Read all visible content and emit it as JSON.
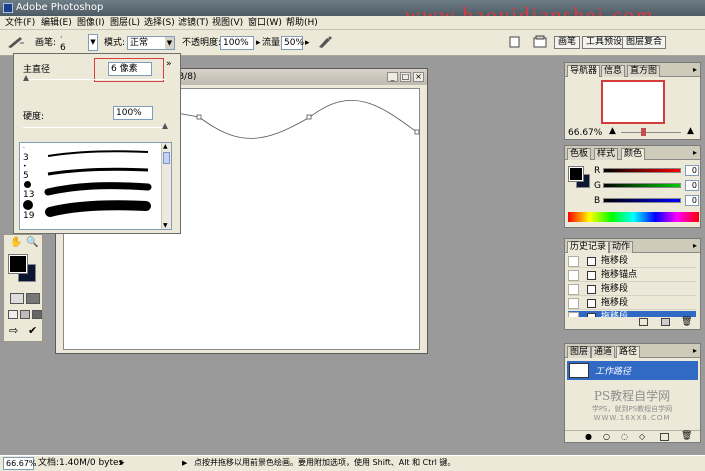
{
  "app": {
    "title": "Adobe Photoshop"
  },
  "watermark_top": "www.haoyidianshej.com",
  "menu": [
    {
      "label": "文件(F)"
    },
    {
      "label": "编辑(E)"
    },
    {
      "label": "图像(I)"
    },
    {
      "label": "图层(L)"
    },
    {
      "label": "选择(S)"
    },
    {
      "label": "滤镜(T)"
    },
    {
      "label": "视图(V)"
    },
    {
      "label": "窗口(W)"
    },
    {
      "label": "帮助(H)"
    }
  ],
  "options": {
    "brush_label": "画笔:",
    "brush_size": "6",
    "mode_label": "模式:",
    "mode_value": "正常",
    "opacity_label": "不透明度:",
    "opacity_value": "100%",
    "flow_label": "流量:",
    "flow_value": "50%"
  },
  "palette_well_tabs": [
    {
      "label": "画笔"
    },
    {
      "label": "工具预设"
    },
    {
      "label": "图层复合"
    }
  ],
  "brush_popup": {
    "master_diameter_label": "主直径",
    "master_diameter_value": "6 像素",
    "master_diameter_fraction": 0.02,
    "hardness_label": "硬度:",
    "hardness_value": "100%",
    "hardness_fraction": 1.0,
    "brushes": [
      {
        "size": "3",
        "stroke": 2
      },
      {
        "size": "5",
        "stroke": 3
      },
      {
        "size": "13",
        "stroke": 8
      },
      {
        "size": "19",
        "stroke": 12
      }
    ]
  },
  "document": {
    "title_fragment": "B/8)"
  },
  "navigator": {
    "tabs": [
      {
        "label": "导航器"
      },
      {
        "label": "信息"
      },
      {
        "label": "直方图"
      }
    ],
    "zoom": "66.67%"
  },
  "color": {
    "tabs": [
      {
        "label": "色板"
      },
      {
        "label": "样式"
      },
      {
        "label": "颜色"
      }
    ],
    "channels": [
      {
        "name": "R",
        "value": "0"
      },
      {
        "name": "G",
        "value": "0"
      },
      {
        "name": "B",
        "value": "0"
      }
    ],
    "foreground": "#000000",
    "background": "#0b1633"
  },
  "history": {
    "tabs": [
      {
        "label": "历史记录"
      },
      {
        "label": "动作"
      }
    ],
    "items": [
      {
        "label": "拖移段",
        "selected": false
      },
      {
        "label": "拖移锚点",
        "selected": false
      },
      {
        "label": "拖移段",
        "selected": false
      },
      {
        "label": "拖移段",
        "selected": false
      },
      {
        "label": "拖移段",
        "selected": true
      }
    ]
  },
  "paths": {
    "tabs": [
      {
        "label": "图层"
      },
      {
        "label": "通道"
      },
      {
        "label": "路径"
      }
    ],
    "items": [
      {
        "label": "工作路径"
      }
    ]
  },
  "watermark_bottom": {
    "line1": "PS教程自学网",
    "line2": "学PS，就到PS教程自学网",
    "line3": "WWW.16XX8.COM"
  },
  "status": {
    "zoom": "66.67%",
    "doc": "文档:1.40M/0 bytes",
    "hint": "点按并拖移以用前景色绘画。要用附加选项，使用 Shift、Alt 和 Ctrl 键。"
  },
  "colors": {
    "selection_blue": "#316ac5",
    "watermark_red": "#e2373c"
  }
}
